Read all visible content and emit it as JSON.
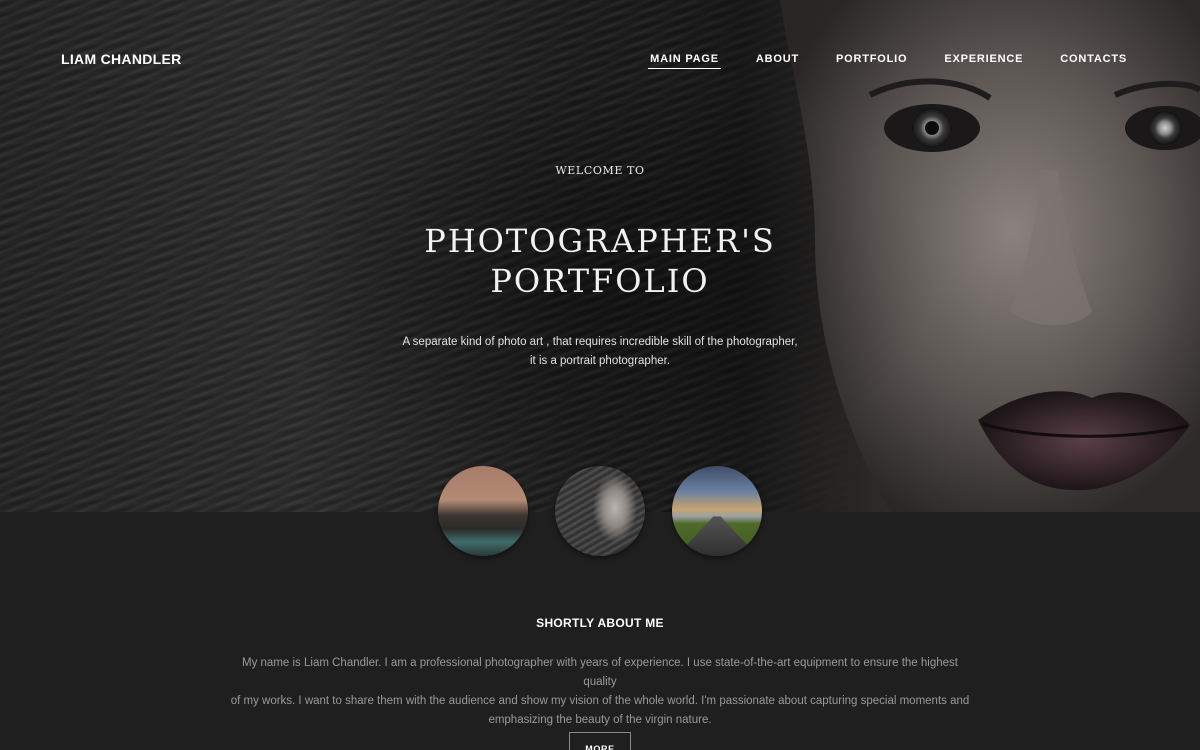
{
  "header": {
    "brand": "LIAM CHANDLER",
    "nav": [
      {
        "label": "MAIN PAGE",
        "active": true
      },
      {
        "label": "ABOUT",
        "active": false
      },
      {
        "label": "PORTFOLIO",
        "active": false
      },
      {
        "label": "EXPERIENCE",
        "active": false
      },
      {
        "label": "CONTACTS",
        "active": false
      }
    ]
  },
  "hero": {
    "welcome": "WELCOME TO",
    "headline_line1": "PHOTOGRAPHER'S",
    "headline_line2": "PORTFOLIO",
    "tagline_line1": "A separate kind of photo art , that requires incredible skill of the photographer,",
    "tagline_line2": "it is a portrait photographer."
  },
  "thumbnails": [
    {
      "subject": "mountain-lake-sunset"
    },
    {
      "subject": "woman-portrait"
    },
    {
      "subject": "storm-road"
    }
  ],
  "about": {
    "title": "SHORTLY ABOUT ME",
    "text_line1": "My name is Liam Chandler. I am a professional photographer with years of experience. I use state-of-the-art equipment to ensure the highest quality",
    "text_line2": "of my works. I want to share them with the audience and show my vision of the whole world. I'm passionate about capturing special moments and",
    "text_line3": "emphasizing the beauty of the virgin nature.",
    "more_label": "MORE"
  },
  "colors": {
    "background": "#1f1f1f",
    "text_primary": "#ffffff",
    "text_muted": "#9a9a9a"
  }
}
